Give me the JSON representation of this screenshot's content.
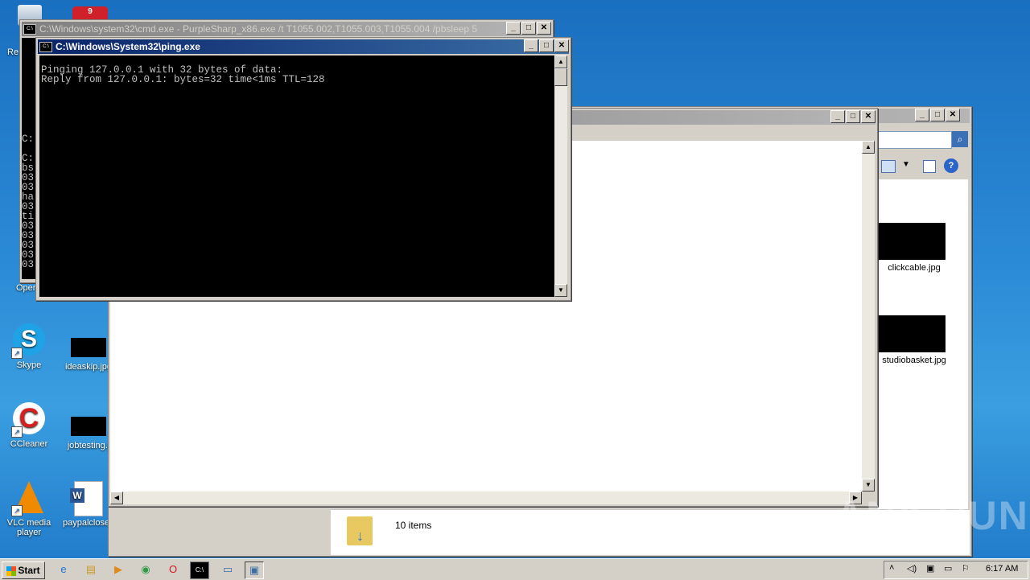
{
  "desktop": {
    "icons": [
      {
        "label": "Skype",
        "glyph": "S"
      },
      {
        "label": "ideaskip.jpg"
      },
      {
        "label": "CCleaner",
        "glyph": "C"
      },
      {
        "label": "jobtesting.j"
      },
      {
        "label": "VLC media player"
      },
      {
        "label": "paypalclose..."
      }
    ],
    "partial_labels": [
      "Re",
      "Oper"
    ],
    "watermark": "ANY RUN"
  },
  "cmd_window": {
    "title": "C:\\Windows\\system32\\cmd.exe - PurpleSharp_x86.exe  /t T1055.002,T1055.003,T1055.004 /pbsleep 5",
    "left_text": "C:\n\nC:\nbs\n03\n03\nha\n03\nti\n03\n03\n03\n03\n03"
  },
  "ping_window": {
    "title": "C:\\Windows\\System32\\ping.exe",
    "output": "Pinging 127.0.0.1 with 32 bytes of data:\nReply from 127.0.0.1: bytes=32 time<1ms TTL=128"
  },
  "explorer_window": {
    "files": [
      {
        "name": "clickcable.jpg"
      },
      {
        "name": "studiobasket.jpg"
      }
    ],
    "status_count": "10 items"
  },
  "taskbar": {
    "start_label": "Start",
    "clock": "6:17 AM"
  }
}
